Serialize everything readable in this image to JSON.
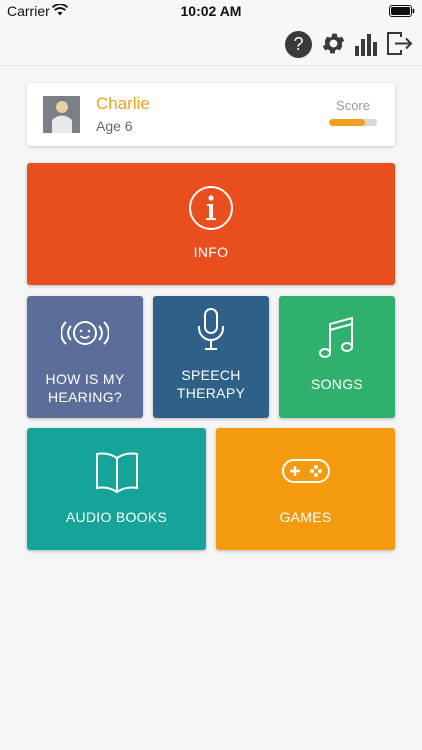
{
  "status_bar": {
    "carrier": "Carrier",
    "time": "10:02 AM"
  },
  "toolbar": {
    "help_glyph": "?",
    "icons": [
      "help-icon",
      "gear-icon",
      "bar-chart-icon",
      "logout-icon"
    ]
  },
  "profile": {
    "name": "Charlie",
    "age": "Age 6",
    "score_label": "Score",
    "score_fraction": 0.75
  },
  "tiles": {
    "info": {
      "label": "INFO",
      "icon": "info-circle-icon"
    },
    "hearing": {
      "label": "HOW IS MY HEARING?",
      "icon": "listening-face-icon"
    },
    "speech": {
      "label": "SPEECH THERAPY",
      "icon": "microphone-icon"
    },
    "songs": {
      "label": "SONGS",
      "icon": "music-note-icon"
    },
    "books": {
      "label": "AUDIO BOOKS",
      "icon": "open-book-icon"
    },
    "games": {
      "label": "GAMES",
      "icon": "gamepad-icon"
    }
  },
  "colors": {
    "accent": "#f0a020",
    "info": "#e94e1e",
    "hearing": "#5a6e99",
    "speech": "#2f6088",
    "songs": "#2fb06c",
    "books": "#16a39a",
    "games": "#f39a0f"
  }
}
